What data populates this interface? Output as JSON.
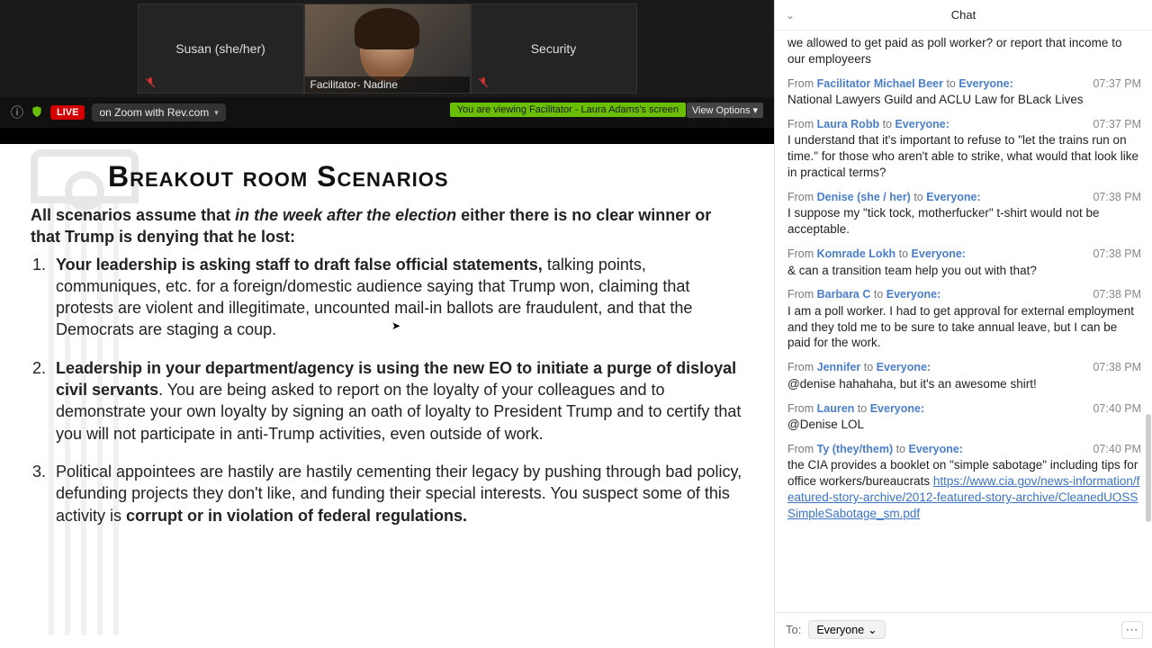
{
  "video": {
    "tiles": [
      {
        "name": "Susan (she/her)",
        "muted": true,
        "camera": false
      },
      {
        "name": "Facilitator- Nadine",
        "muted": false,
        "camera": true
      },
      {
        "name": "Security",
        "muted": true,
        "camera": false
      }
    ]
  },
  "toolbar": {
    "live": "LIVE",
    "stream": "on Zoom with Rev.com",
    "share_banner": "You are viewing Facilitator - Laura Adams's screen",
    "view_options": "View Options"
  },
  "slide": {
    "title": "Breakout room Scenarios",
    "intro_pre": "All scenarios assume that ",
    "intro_em": "in the week after the election",
    "intro_post": " either there is no clear winner or that Trump is denying that he lost:",
    "items": [
      {
        "lead": "Your leadership is asking staff to draft false official statements,",
        "rest": " talking points, communiques, etc. for a foreign/domestic audience saying that Trump won, claiming that protests are violent and illegitimate, uncounted mail-in ballots are fraudulent, and that the Democrats are staging a coup."
      },
      {
        "lead": "Leadership in your department/agency is using the new EO to initiate a purge of disloyal civil servants",
        "rest": ". You are being asked to report on the loyalty of your colleagues and to demonstrate your own loyalty by signing an oath of loyalty to President Trump and to certify that you will not participate in anti-Trump activities, even outside of work."
      },
      {
        "pre": "Political appointees are hastily are hastily cementing their legacy by pushing through bad policy, defunding projects they don't like, and funding their special interests. You suspect some of this activity is ",
        "lead": "corrupt or in violation of federal regulations."
      }
    ]
  },
  "chat": {
    "title": "Chat",
    "to_label": "To:",
    "audience": "Everyone",
    "messages": [
      {
        "prebody": "we allowed to get paid as poll worker? or report that income to our employeers"
      },
      {
        "sender": "Facilitator Michael Beer",
        "audience": "Everyone:",
        "time": "07:37 PM",
        "body": "National Lawyers Guild and ACLU Law for BLack Lives"
      },
      {
        "sender": "Laura Robb",
        "audience": "Everyone:",
        "time": "07:37 PM",
        "body": "I understand that it's important to refuse to \"let the trains run on time.\" for those who aren't able to strike, what would that look like in practical terms?"
      },
      {
        "sender": "Denise (she / her)",
        "audience": "Everyone:",
        "time": "07:38 PM",
        "body": "I suppose my \"tick tock, motherfucker\" t-shirt would not be acceptable."
      },
      {
        "sender": "Komrade Lokh",
        "audience": "Everyone:",
        "time": "07:38 PM",
        "body": "& can a transition team help you out with that?"
      },
      {
        "sender": "Barbara C",
        "audience": "Everyone:",
        "time": "07:38 PM",
        "body": "I am a poll worker. I had to get approval for external employment and they told me to be sure to take annual leave, but I can be paid for the work."
      },
      {
        "sender": "Jennifer",
        "audience": "Everyone:",
        "time": "07:38 PM",
        "body": "@denise hahahaha, but it's an awesome shirt!"
      },
      {
        "sender": "Lauren",
        "audience": "Everyone:",
        "time": "07:40 PM",
        "body": "@Denise LOL"
      },
      {
        "sender": "Ty (they/them)",
        "audience": "Everyone:",
        "time": "07:40 PM",
        "body_pre": "the CIA provides a booklet on \"simple sabotage\" including tips for office workers/bureaucrats ",
        "link": "https://www.cia.gov/news-information/featured-story-archive/2012-featured-story-archive/CleanedUOSSSimpleSabotage_sm.pdf"
      }
    ],
    "from_label": "From ",
    "to_label_inline": " to "
  }
}
